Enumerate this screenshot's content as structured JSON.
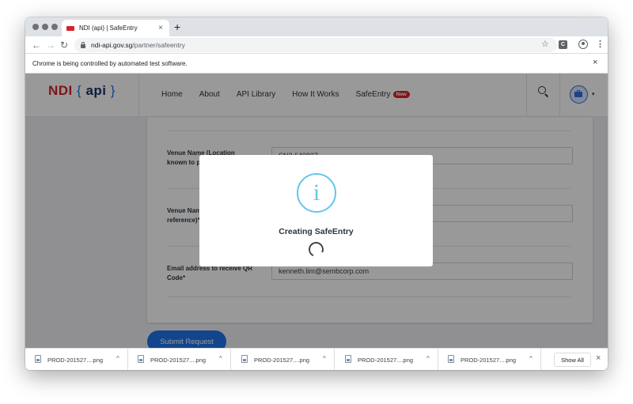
{
  "browser": {
    "tab_title": "NDI (api) | SafeEntry",
    "tab_close": "×",
    "new_tab": "+",
    "url_host": "ndi-api.gov.sg",
    "url_path": "/partner/safeentry",
    "back": "←",
    "forward": "→",
    "reload": "↻",
    "star": "☆",
    "extension": "C",
    "menu": "⋮",
    "infobar_text": "Chrome is being controlled by automated test software.",
    "infobar_close": "×"
  },
  "site": {
    "logo_ndi": "NDI",
    "logo_open": "{",
    "logo_api": "api",
    "logo_close": "}",
    "nav": [
      {
        "label": "Home"
      },
      {
        "label": "About"
      },
      {
        "label": "API Library"
      },
      {
        "label": "How It Works"
      },
      {
        "label": "SafeEntry",
        "badge": "New"
      }
    ],
    "account_caret": "▾"
  },
  "form": {
    "fields": [
      {
        "label": "Venue Name (Location known to public)*",
        "value": "SN3 640837"
      },
      {
        "label": "Venue Name (Internal reference)*",
        "value": ""
      },
      {
        "label": "Email address to receive QR Code*",
        "value": "kenneth.lim@sembcorp.com"
      }
    ],
    "submit_label": "Submit Request"
  },
  "modal": {
    "icon_glyph": "i",
    "title": "Creating SafeEntry"
  },
  "downloads": {
    "items": [
      {
        "name": "PROD-201527....png"
      },
      {
        "name": "PROD-201527....png"
      },
      {
        "name": "PROD-201527....png"
      },
      {
        "name": "PROD-201527....png"
      },
      {
        "name": "PROD-201527....png"
      }
    ],
    "caret": "^",
    "show_all": "Show All",
    "close": "×"
  },
  "colors": {
    "brand_red": "#d8222a",
    "brand_blue": "#1e73e8",
    "info_cyan": "#64c6e8"
  }
}
